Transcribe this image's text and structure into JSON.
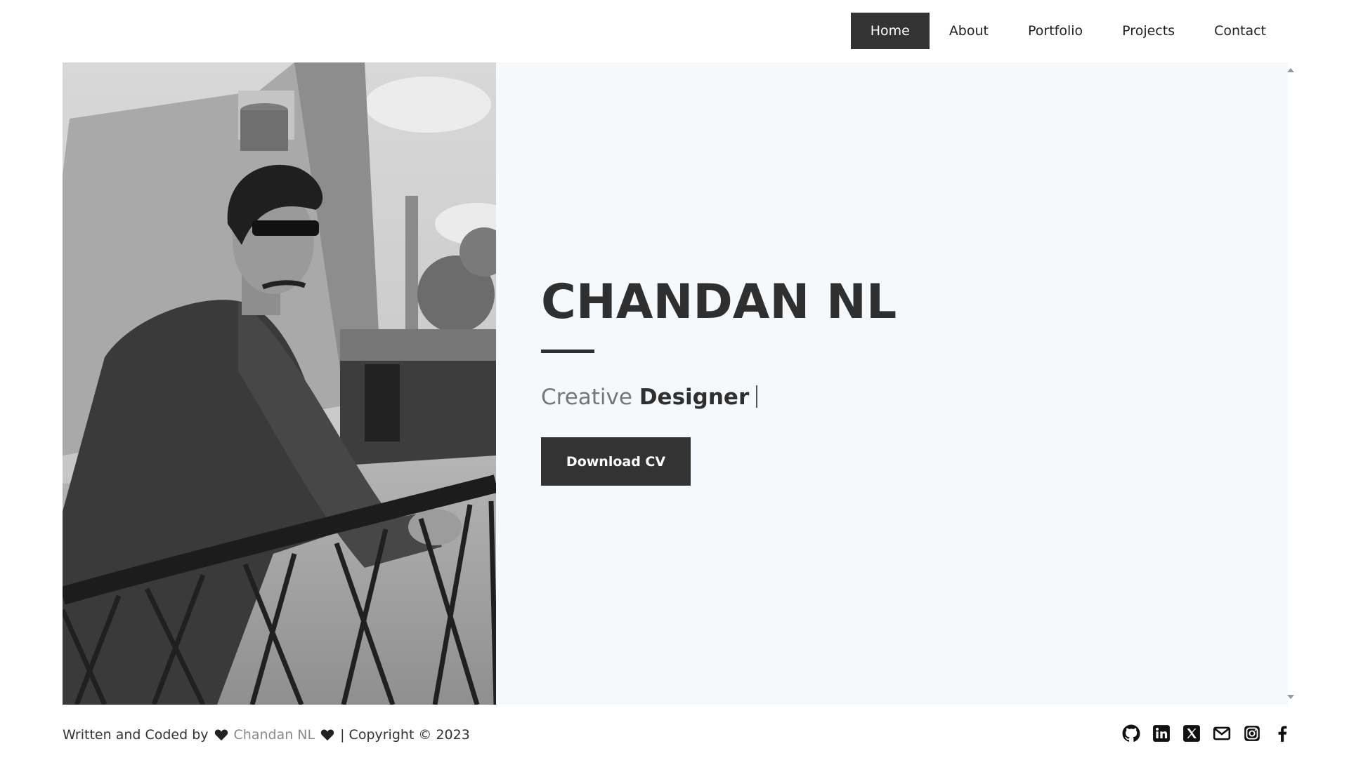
{
  "nav": {
    "items": [
      {
        "label": "Home",
        "active": true
      },
      {
        "label": "About",
        "active": false
      },
      {
        "label": "Portfolio",
        "active": false
      },
      {
        "label": "Projects",
        "active": false
      },
      {
        "label": "Contact",
        "active": false
      }
    ]
  },
  "hero": {
    "name": "CHANDAN NL",
    "role_prefix": "Creative",
    "role_word": "Designer",
    "cta_label": "Download CV"
  },
  "footer": {
    "prefix": "Written and Coded by",
    "author": "Chandan NL",
    "suffix": "| Copyright © 2023",
    "socials": [
      "github-icon",
      "linkedin-icon",
      "x-icon",
      "mail-icon",
      "instagram-icon",
      "facebook-icon"
    ]
  },
  "colors": {
    "dark": "#333333",
    "panel": "#f5f9fc",
    "muted": "#8a8a8a"
  }
}
